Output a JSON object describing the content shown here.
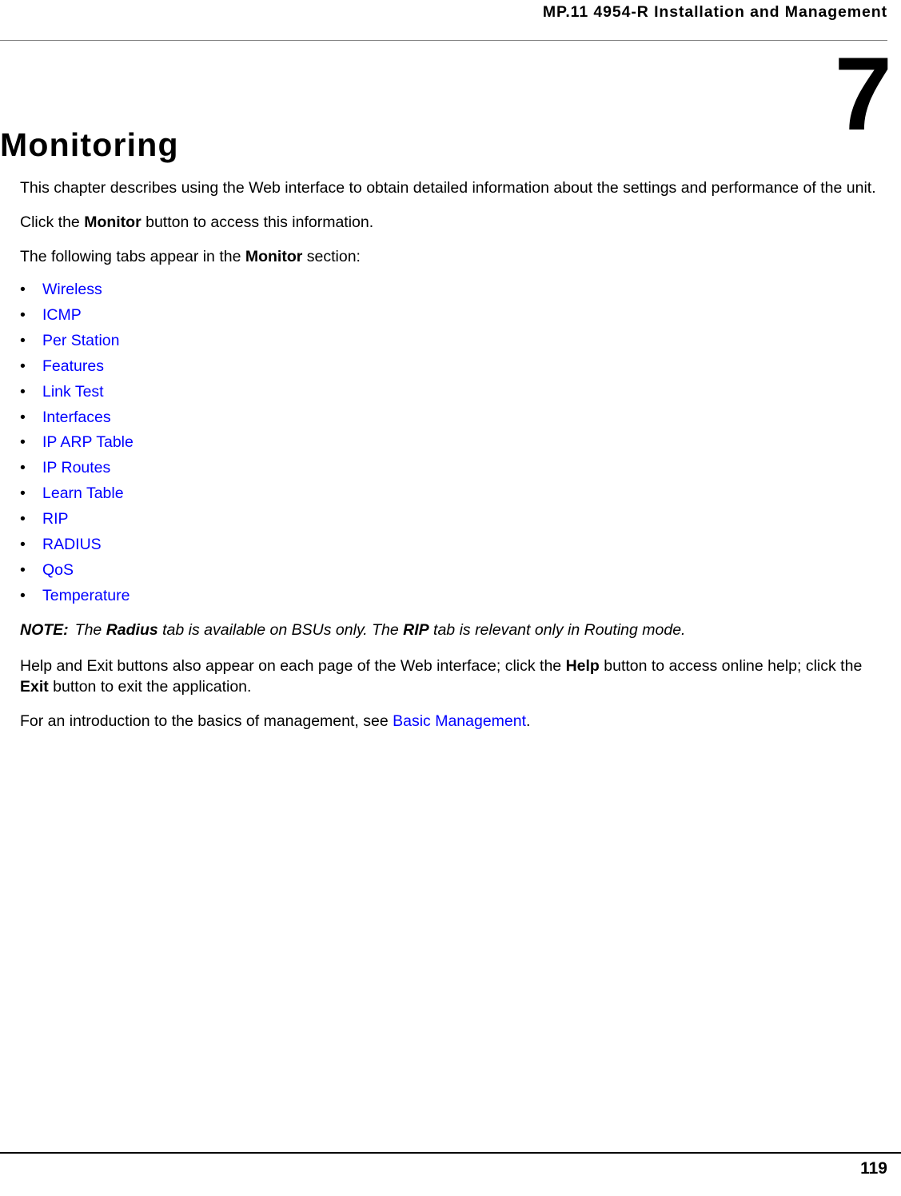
{
  "header": {
    "running_head": "MP.11 4954-R Installation and Management"
  },
  "chapter": {
    "number": "7",
    "title": "Monitoring"
  },
  "intro": {
    "paragraph_1": "This chapter describes using the Web interface to obtain detailed information about the settings and performance of the unit.",
    "paragraph_2_before": "Click the ",
    "paragraph_2_bold": "Monitor",
    "paragraph_2_after": " button to access this information.",
    "paragraph_3_before": "The following tabs appear in the ",
    "paragraph_3_bold": "Monitor",
    "paragraph_3_after": " section:"
  },
  "tab_list": {
    "bullet_glyph": "•",
    "items": [
      {
        "label": "Wireless"
      },
      {
        "label": "ICMP"
      },
      {
        "label": "Per Station"
      },
      {
        "label": "Features"
      },
      {
        "label": "Link Test"
      },
      {
        "label": "Interfaces"
      },
      {
        "label": "IP ARP Table"
      },
      {
        "label": "IP Routes"
      },
      {
        "label": "Learn Table"
      },
      {
        "label": "RIP"
      },
      {
        "label": "RADIUS"
      },
      {
        "label": "QoS"
      },
      {
        "label": "Temperature"
      }
    ]
  },
  "note": {
    "label": "NOTE:",
    "text_1": "The ",
    "bold_1": "Radius",
    "text_2": " tab is available on BSUs only. The ",
    "bold_2": "RIP",
    "text_3": " tab is relevant only in Routing mode."
  },
  "help_exit": {
    "text_1": "Help and Exit buttons also appear on each page of the Web interface; click the ",
    "bold_1": "Help",
    "text_2": " button to access online help; click the ",
    "bold_2": "Exit",
    "text_3": " button to exit the application."
  },
  "basics": {
    "text_1": "For an introduction to the basics of management, see ",
    "link": "Basic Management",
    "text_2": "."
  },
  "footer": {
    "page_number": "119"
  },
  "colors": {
    "link": "#0000FF",
    "text": "#000000",
    "header_rule": "#808080",
    "footer_rule": "#000000",
    "background": "#FFFFFF"
  }
}
